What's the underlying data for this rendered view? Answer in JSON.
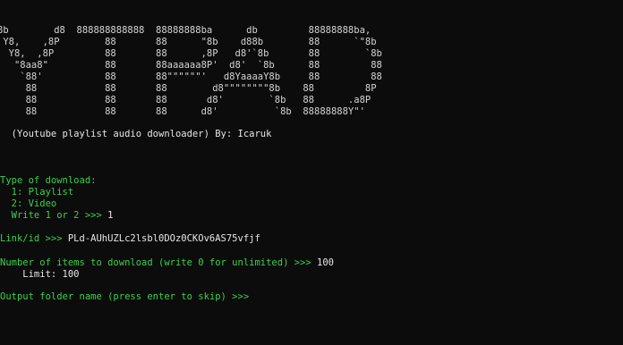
{
  "banner": {
    "lines": [
      "8b        d8  888888888888  88888888ba      db         88888888ba,",
      " Y8,    ,8P        88       88      \"8b    d88b        88      `\"8b",
      "  Y8,  ,8P         88       88      ,8P   d8'`8b       88        `8b",
      "   \"8aa8\"          88       88aaaaaa8P'  d8'  `8b      88         88",
      "    `88'           88       88\"\"\"\"\"\"'   d8YaaaaY8b     88         88",
      "     88            88       88        d8\"\"\"\"\"\"\"\"8b    88         8P",
      "     88            88       88       d8'        `8b   88      .a8P",
      "     88            88       88      d8'          `8b  88888888Y\"'"
    ]
  },
  "subtitle": "  (Youtube playlist audio downloader) By: Icaruk",
  "menu": {
    "prompt": "Type of download:",
    "option1": "  1: Playlist",
    "option2": "  2: Video",
    "choice_prompt": "  Write 1 or 2 >>> ",
    "choice_value": "1"
  },
  "link": {
    "prompt": "Link/id >>> ",
    "value": "PLd-AUhUZLc2lsbl0DOz0CKOv6AS75vfjf"
  },
  "items": {
    "prompt": "Number of items to download (write 0 for unlimited) >>> ",
    "value": "100",
    "limit_line": "    Limit: 100"
  },
  "output": {
    "prompt": "Output folder name (press enter to skip) >>> "
  },
  "colors": {
    "background": "#0c0c0c",
    "prompt_green": "#3bd14a",
    "text_white": "#e6e6e6"
  }
}
